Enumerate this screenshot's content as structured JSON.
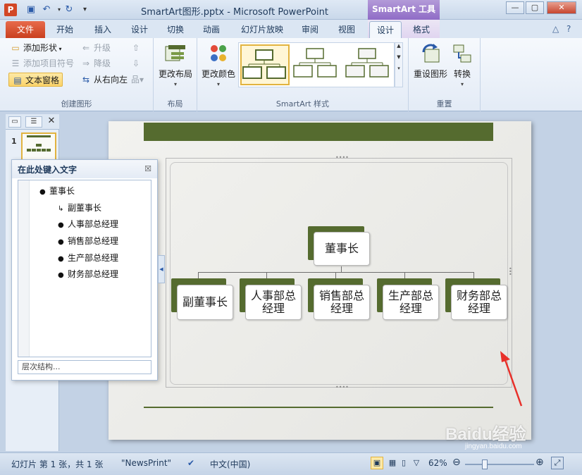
{
  "window": {
    "title": "SmartArt图形.pptx  -  Microsoft PowerPoint",
    "context_title": "SmartArt 工具"
  },
  "tabs": {
    "file": "文件",
    "items": [
      "开始",
      "插入",
      "设计",
      "切换",
      "动画",
      "幻灯片放映",
      "审阅",
      "视图",
      "设计",
      "格式"
    ],
    "active": "设计"
  },
  "ribbon": {
    "create_group": {
      "label": "创建图形",
      "add_shape": "添加形状",
      "add_bullet": "添加项目符号",
      "text_pane": "文本窗格",
      "promote": "升级",
      "demote": "降级",
      "right_to_left": "从右向左"
    },
    "layout_group": {
      "label": "布局",
      "change_layout": "更改布局"
    },
    "style_group": {
      "label": "SmartArt 样式",
      "change_colors": "更改颜色"
    },
    "reset_group": {
      "label": "重置",
      "reset_graphic": "重设图形",
      "convert": "转换"
    }
  },
  "slides_pane": {
    "number": "1"
  },
  "text_pane": {
    "title": "在此处键入文字",
    "items": [
      "董事长",
      "副董事长",
      "人事部总经理",
      "销售部总经理",
      "生产部总经理",
      "财务部总经理"
    ],
    "footer": "层次结构..."
  },
  "smartart": {
    "top": "董事长",
    "children": [
      "副董事长",
      "人事部总\n经理",
      "销售部总\n经理",
      "生产部总\n经理",
      "财务部总\n经理"
    ]
  },
  "status": {
    "slide_info": "幻灯片 第 1 张，共 1 张",
    "theme": "\"NewsPrint\"",
    "language": "中文(中国)",
    "zoom": "62%",
    "zoom_level_percent": 62
  },
  "colors": {
    "accent_green": "#556b2f",
    "file_tab": "#c9401f",
    "context_purple": "#8f6cc6"
  },
  "watermark": {
    "text": "Baidu经验",
    "sub": "jingyan.baidu.com"
  }
}
